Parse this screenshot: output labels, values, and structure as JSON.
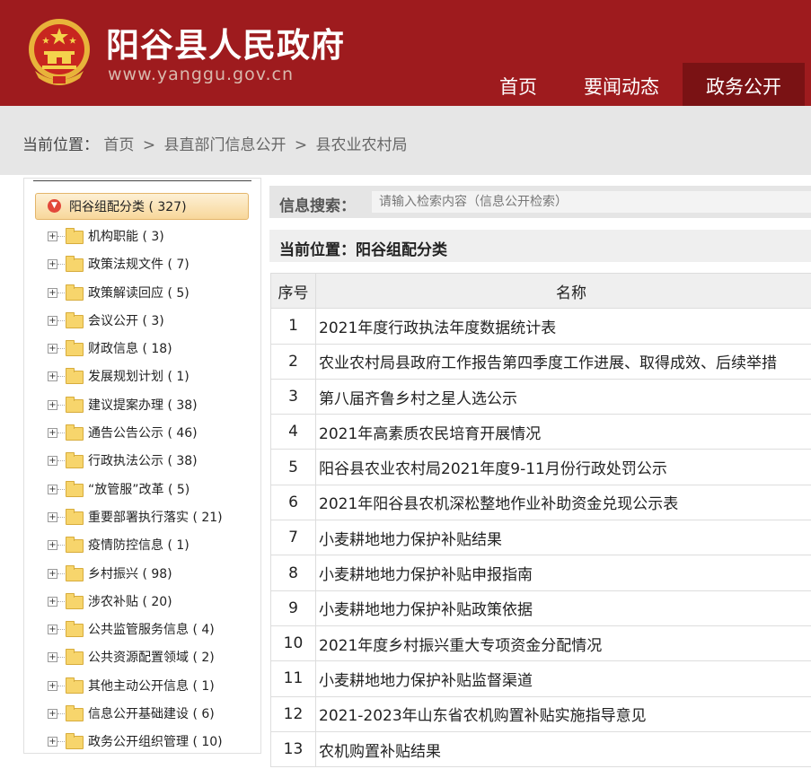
{
  "header": {
    "site_title": "阳谷县人民政府",
    "site_url": "www.yanggu.gov.cn",
    "brand_color": "#9e1b1e",
    "nav": [
      {
        "label": "首页",
        "active": false
      },
      {
        "label": "要闻动态",
        "active": false
      },
      {
        "label": "政务公开",
        "active": true
      }
    ]
  },
  "breadcrumb": {
    "prefix": "当前位置：",
    "items": [
      "首页",
      "县直部门信息公开",
      "县农业农村局"
    ],
    "separator": ">"
  },
  "sidebar": {
    "root": {
      "label": "阳谷组配分类 ( 327)"
    },
    "items": [
      {
        "label": "机构职能 ( 3)"
      },
      {
        "label": "政策法规文件 ( 7)"
      },
      {
        "label": "政策解读回应 ( 5)"
      },
      {
        "label": "会议公开 ( 3)"
      },
      {
        "label": "财政信息 ( 18)"
      },
      {
        "label": "发展规划计划 ( 1)"
      },
      {
        "label": "建议提案办理 ( 38)"
      },
      {
        "label": "通告公告公示 ( 46)"
      },
      {
        "label": "行政执法公示 ( 38)"
      },
      {
        "label": "“放管服”改革 ( 5)"
      },
      {
        "label": "重要部署执行落实 ( 21)"
      },
      {
        "label": "疫情防控信息 ( 1)"
      },
      {
        "label": "乡村振兴 ( 98)"
      },
      {
        "label": "涉农补贴 ( 20)"
      },
      {
        "label": "公共监管服务信息 ( 4)"
      },
      {
        "label": "公共资源配置领域 ( 2)"
      },
      {
        "label": "其他主动公开信息 ( 1)"
      },
      {
        "label": "信息公开基础建设 ( 6)"
      },
      {
        "label": "政务公开组织管理 ( 10)"
      }
    ]
  },
  "search": {
    "label": "信息搜索：",
    "placeholder": "请输入检索内容（信息公开检索）"
  },
  "current_position": {
    "text": "当前位置：阳谷组配分类"
  },
  "table": {
    "headers": [
      "序号",
      "名称"
    ],
    "rows": [
      {
        "index": "1",
        "name": "2021年度行政执法年度数据统计表"
      },
      {
        "index": "2",
        "name": "农业农村局县政府工作报告第四季度工作进展、取得成效、后续举措"
      },
      {
        "index": "3",
        "name": "第八届齐鲁乡村之星人选公示"
      },
      {
        "index": "4",
        "name": "2021年高素质农民培育开展情况"
      },
      {
        "index": "5",
        "name": "阳谷县农业农村局2021年度9-11月份行政处罚公示"
      },
      {
        "index": "6",
        "name": "2021年阳谷县农机深松整地作业补助资金兑现公示表"
      },
      {
        "index": "7",
        "name": "小麦耕地地力保护补贴结果"
      },
      {
        "index": "8",
        "name": "小麦耕地地力保护补贴申报指南"
      },
      {
        "index": "9",
        "name": "小麦耕地地力保护补贴政策依据"
      },
      {
        "index": "10",
        "name": "2021年度乡村振兴重大专项资金分配情况"
      },
      {
        "index": "11",
        "name": "小麦耕地地力保护补贴监督渠道"
      },
      {
        "index": "12",
        "name": "2021-2023年山东省农机购置补贴实施指导意见"
      },
      {
        "index": "13",
        "name": "农机购置补贴结果"
      }
    ]
  }
}
